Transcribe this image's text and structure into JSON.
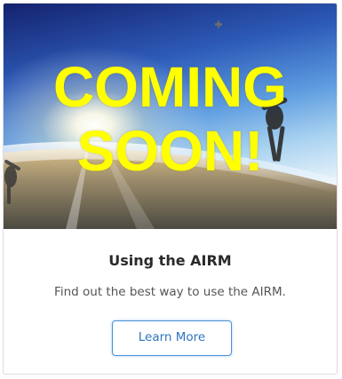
{
  "card": {
    "overlay": {
      "line1": "COMING",
      "line2": "SOON!"
    },
    "title": "Using the AIRM",
    "description": "Find out the best way to use the AIRM.",
    "button_label": "Learn More"
  },
  "colors": {
    "overlay_text": "#ffff00",
    "button_border": "#4a90d9",
    "button_text": "#2e74c0",
    "sky_top": "#1b2f8a",
    "sky_mid": "#3f7fd0"
  }
}
